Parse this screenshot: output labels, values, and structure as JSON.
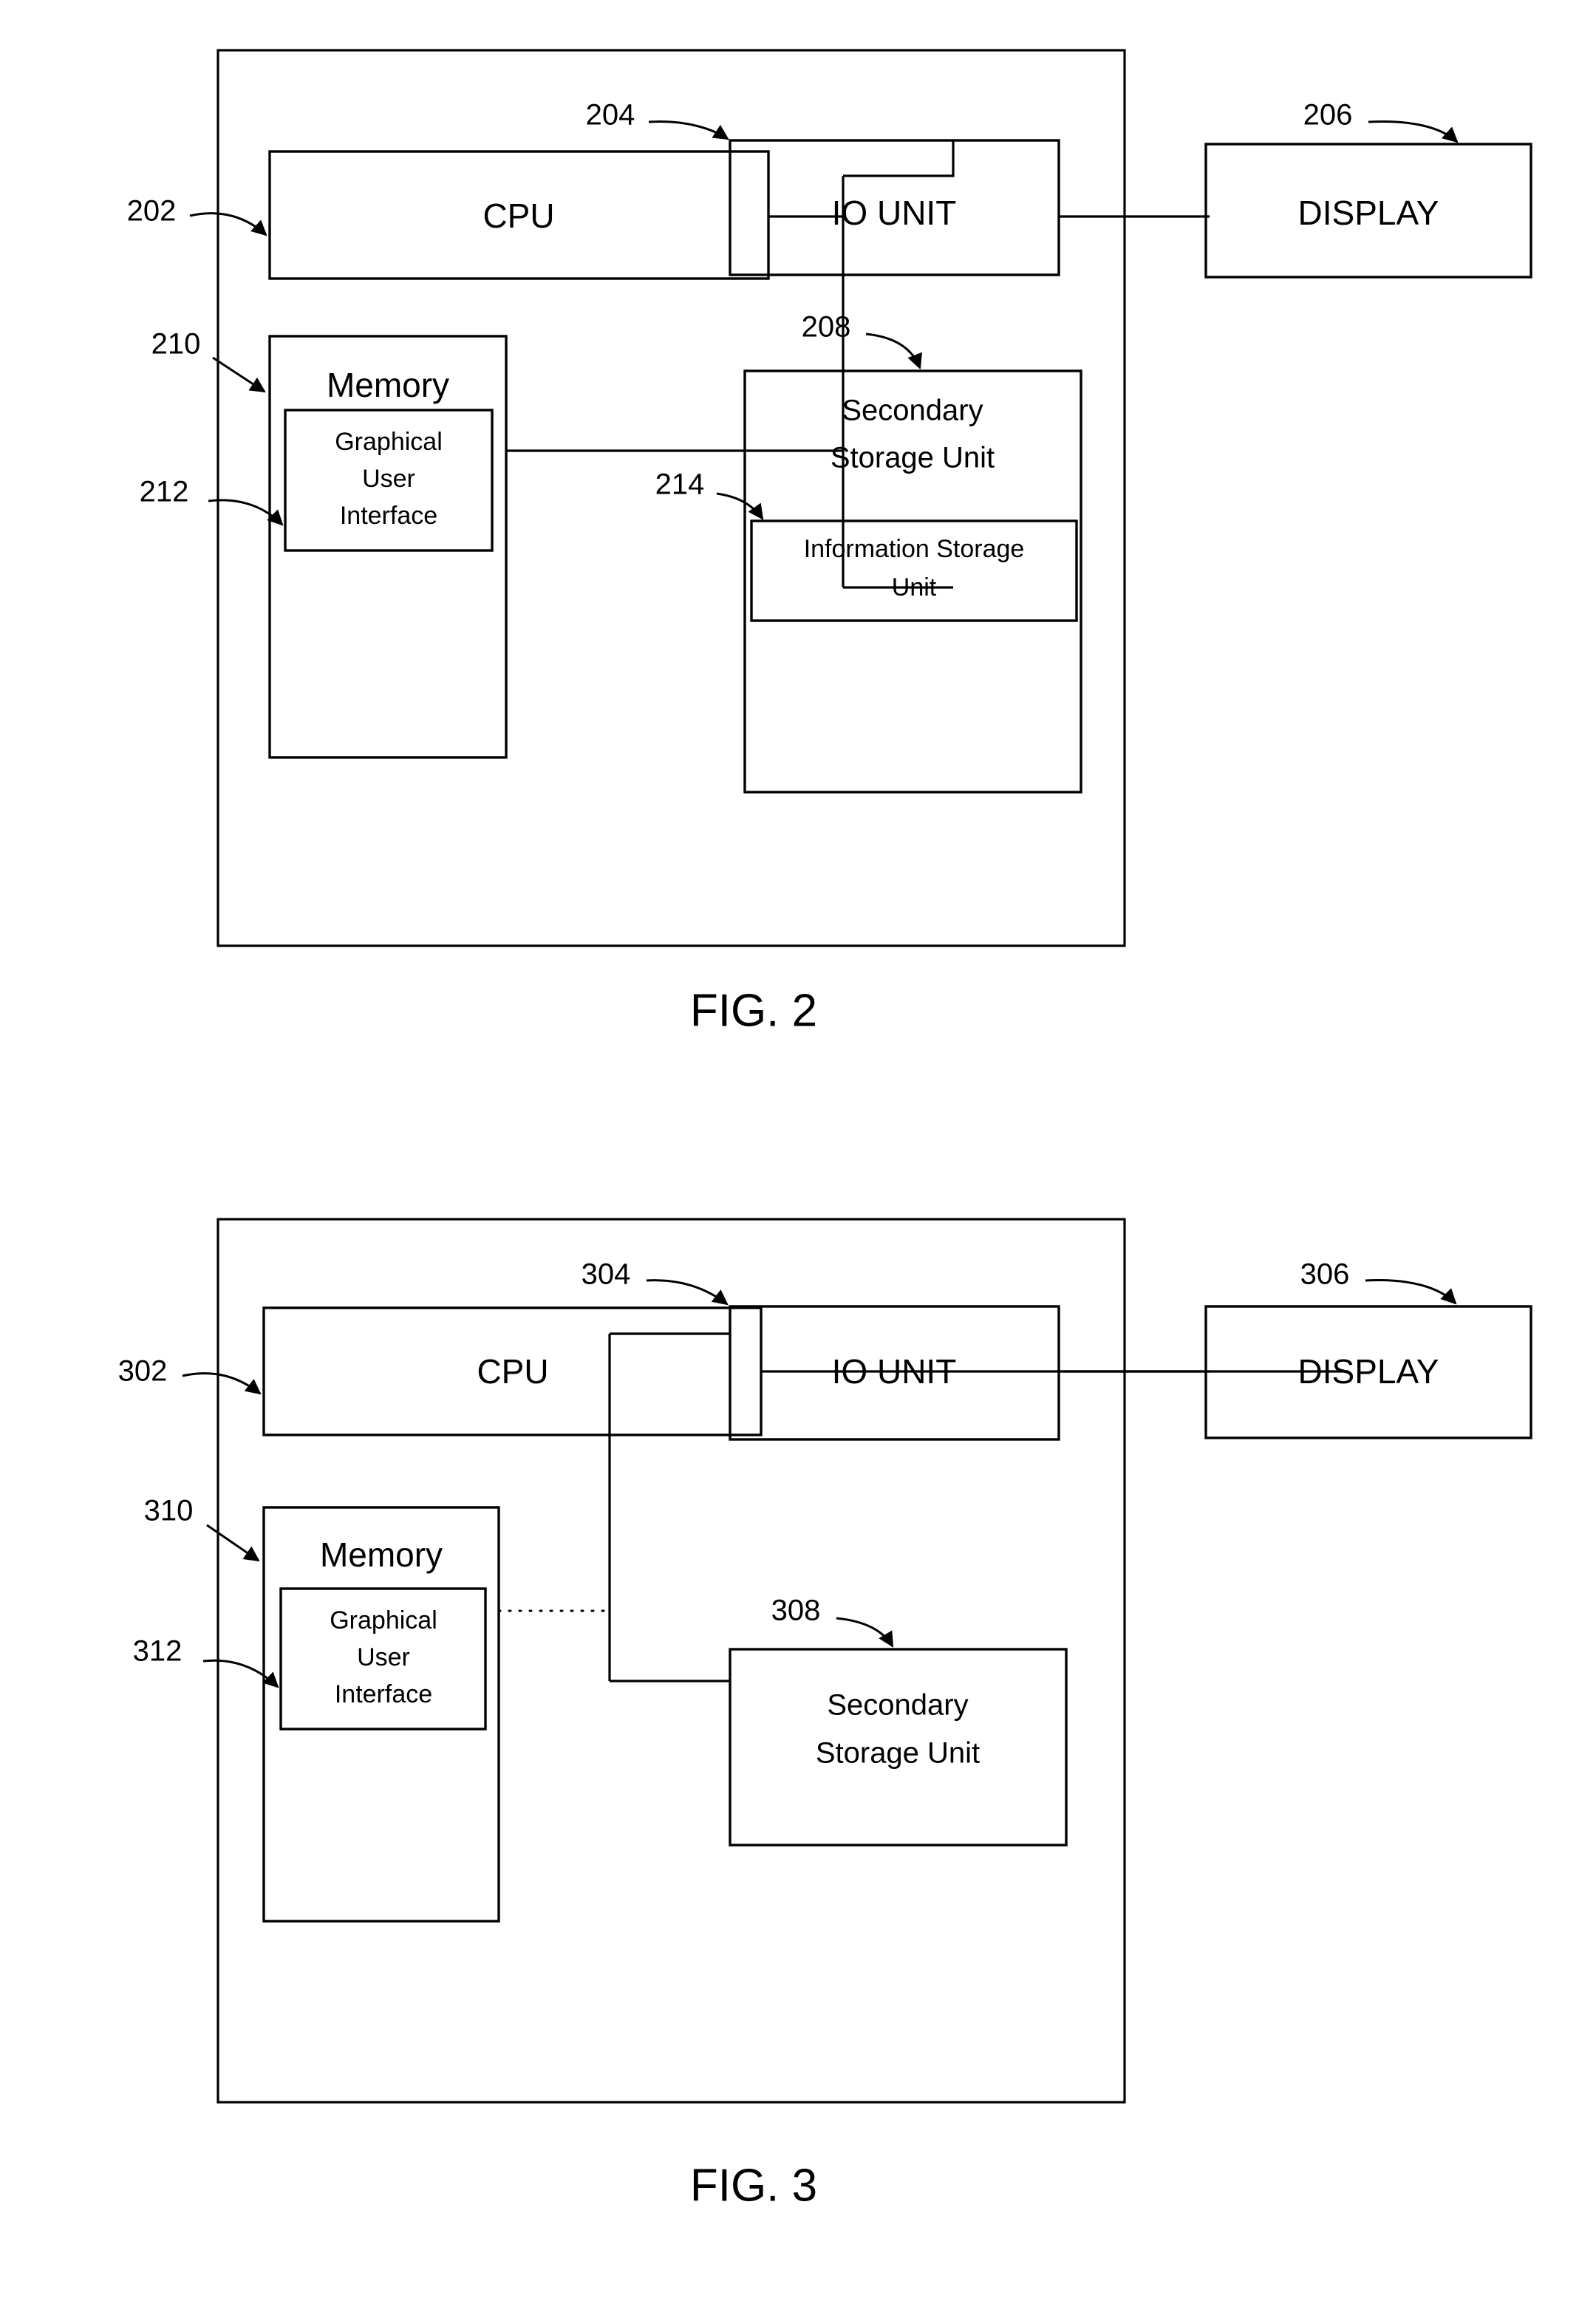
{
  "document": {
    "type": "patent-drawing-sheet",
    "figures": [
      {
        "id": "fig2",
        "caption": "FIG. 2",
        "blocks": [
          {
            "key": "cpu",
            "label": "CPU",
            "ref": "202"
          },
          {
            "key": "io",
            "label": "IO UNIT",
            "ref": "204"
          },
          {
            "key": "display",
            "label": "DISPLAY",
            "ref": "206"
          },
          {
            "key": "memory",
            "label": "Memory",
            "ref": "210"
          },
          {
            "key": "gui",
            "label_line1": "Graphical",
            "label_line2": "User",
            "label_line3": "Interface",
            "ref": "212"
          },
          {
            "key": "secondary",
            "label_line1": "Secondary",
            "label_line2": "Storage Unit",
            "ref": "208"
          },
          {
            "key": "infostore",
            "label_line1": "Information Storage",
            "label_line2": "Unit",
            "ref": "214"
          }
        ]
      },
      {
        "id": "fig3",
        "caption": "FIG. 3",
        "blocks": [
          {
            "key": "cpu",
            "label": "CPU",
            "ref": "302"
          },
          {
            "key": "io",
            "label": "IO UNIT",
            "ref": "304"
          },
          {
            "key": "display",
            "label": "DISPLAY",
            "ref": "306"
          },
          {
            "key": "memory",
            "label": "Memory",
            "ref": "310"
          },
          {
            "key": "gui",
            "label_line1": "Graphical",
            "label_line2": "User",
            "label_line3": "Interface",
            "ref": "312"
          },
          {
            "key": "secondary",
            "label_line1": "Secondary",
            "label_line2": "Storage Unit",
            "ref": "308"
          }
        ]
      }
    ],
    "colors": {
      "line": "#000000",
      "background": "#ffffff",
      "text": "#000000"
    }
  },
  "fig2": {
    "caption": "FIG. 2",
    "cpu": {
      "label": "CPU",
      "ref": "202"
    },
    "io": {
      "label": "IO UNIT",
      "ref": "204"
    },
    "display": {
      "label": "DISPLAY",
      "ref": "206"
    },
    "memory": {
      "label": "Memory",
      "ref": "210"
    },
    "gui": {
      "ref": "212",
      "line1": "Graphical",
      "line2": "User",
      "line3": "Interface"
    },
    "secondary": {
      "ref": "208",
      "line1": "Secondary",
      "line2": "Storage Unit"
    },
    "infostore": {
      "ref": "214",
      "line1": "Information Storage",
      "line2": "Unit"
    }
  },
  "fig3": {
    "caption": "FIG. 3",
    "cpu": {
      "label": "CPU",
      "ref": "302"
    },
    "io": {
      "label": "IO UNIT",
      "ref": "304"
    },
    "display": {
      "label": "DISPLAY",
      "ref": "306"
    },
    "memory": {
      "label": "Memory",
      "ref": "310"
    },
    "gui": {
      "ref": "312",
      "line1": "Graphical",
      "line2": "User",
      "line3": "Interface"
    },
    "secondary": {
      "ref": "308",
      "line1": "Secondary",
      "line2": "Storage Unit"
    }
  }
}
